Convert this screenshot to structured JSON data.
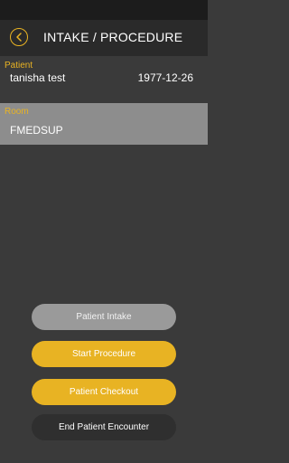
{
  "header": {
    "title": "INTAKE / PROCEDURE",
    "back_icon": "chevron-left-icon"
  },
  "patient": {
    "label": "Patient",
    "name": "tanisha test",
    "dob": "1977-12-26"
  },
  "room": {
    "label": "Room",
    "value": "FMEDSUP"
  },
  "actions": {
    "intake": "Patient Intake",
    "start_procedure": "Start Procedure",
    "checkout": "Patient Checkout",
    "end_encounter": "End Patient Encounter"
  },
  "colors": {
    "accent": "#e8b323",
    "background": "#3a3a3a",
    "header": "#2a2a2a",
    "room_band": "#8d8d8d",
    "intake_button": "#9a9a9a",
    "end_button": "#2f2f2f"
  }
}
